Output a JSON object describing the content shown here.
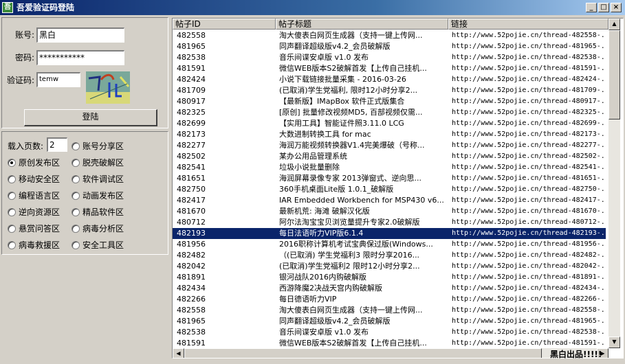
{
  "window": {
    "app_icon_text": "吾",
    "title": "吾爱验证码登陆",
    "minimize": "_",
    "maximize": "□",
    "close": "×"
  },
  "login": {
    "account_label": "账号:",
    "account_value": "黑白",
    "password_label": "密码:",
    "password_value": "***********",
    "captcha_label": "验证码:",
    "captcha_value": "temw",
    "login_button": "登陆"
  },
  "options": {
    "pages_label": "载入页数:",
    "pages_value": "2",
    "selected": "原创发布区",
    "radios": [
      "账号分享区",
      "原创发布区",
      "脱壳破解区",
      "移动安全区",
      "软件调试区",
      "编程语言区",
      "动画发布区",
      "逆向资源区",
      "精品软件区",
      "悬赏问答区",
      "病毒分析区",
      "病毒救援区",
      "安全工具区"
    ]
  },
  "table": {
    "headers": [
      "帖子ID",
      "帖子标题",
      "链接"
    ],
    "selected_index": 19,
    "rows": [
      [
        "482558",
        "淘大傻表白网页生成器（支持一键上传网...",
        "http://www.52pojie.cn/thread-482558-..."
      ],
      [
        "481965",
        "同声翻译超级版v4.2_会员破解版",
        "http://www.52pojie.cn/thread-481965-..."
      ],
      [
        "482538",
        "音乐间谍安卓版 v1.0 发布",
        "http://www.52pojie.cn/thread-482538-..."
      ],
      [
        "481591",
        "微信WEB版本S2破解首发【上传自己挂机...",
        "http://www.52pojie.cn/thread-481591-..."
      ],
      [
        "482424",
        "小说下载链接批量采集 -  2016-03-26",
        "http://www.52pojie.cn/thread-482424-..."
      ],
      [
        "481709",
        "(已取消)学生党福利, 限时12小时分享2...",
        "http://www.52pojie.cn/thread-481709-..."
      ],
      [
        "480917",
        "【最新版】IMapBox 软件正式版集合",
        "http://www.52pojie.cn/thread-480917-..."
      ],
      [
        "482325",
        "[原创] 批量修改视频MD5, 百部视频仅需...",
        "http://www.52pojie.cn/thread-482325-..."
      ],
      [
        "482699",
        "【实用工具】智能证件照3.11.0 LCG",
        "http://www.52pojie.cn/thread-482699-..."
      ],
      [
        "482173",
        "大数进制转换工具 for mac",
        "http://www.52pojie.cn/thread-482173-..."
      ],
      [
        "482277",
        "海润万能视频转换器V1.4完美爆破（号称...",
        "http://www.52pojie.cn/thread-482277-..."
      ],
      [
        "482502",
        "某办公用品管理系统",
        "http://www.52pojie.cn/thread-482502-..."
      ],
      [
        "482541",
        "垃圾小说批量删除",
        "http://www.52pojie.cn/thread-482541-..."
      ],
      [
        "481651",
        "海润屏幕录像专家 2013弹窗式、逆向思...",
        "http://www.52pojie.cn/thread-481651-..."
      ],
      [
        "482750",
        "360手机桌面Lite版 1.0.1_破解版",
        "http://www.52pojie.cn/thread-482750-..."
      ],
      [
        "482417",
        "IAR Embedded Workbench for MSP430 v6...",
        "http://www.52pojie.cn/thread-482417-..."
      ],
      [
        "481670",
        "最新机荒: 海滩 破解汉化版",
        "http://www.52pojie.cn/thread-481670-..."
      ],
      [
        "480712",
        "阿尔法淘宝宝贝浏览量提升专家2.0破解版",
        "http://www.52pojie.cn/thread-480712-..."
      ],
      [
        "482193",
        "每日法语听力VIP版6.1.4",
        "http://www.52pojie.cn/thread-482193-..."
      ],
      [
        "481956",
        "2016职称计算机考试宝典保过版(Windows...",
        "http://www.52pojie.cn/thread-481956-..."
      ],
      [
        "482482",
        "（(已取消) 学生党福利3 限时分享2016...",
        "http://www.52pojie.cn/thread-482482-..."
      ],
      [
        "482042",
        "(已取消)学生党福利2 限时12小时分享2...",
        "http://www.52pojie.cn/thread-482042-..."
      ],
      [
        "481891",
        "银河战队2016内购破解版",
        "http://www.52pojie.cn/thread-481891-..."
      ],
      [
        "482434",
        "西游降魔2决战天宫内购破解版",
        "http://www.52pojie.cn/thread-482434-..."
      ],
      [
        "482266",
        "每日德语听力VIP",
        "http://www.52pojie.cn/thread-482266-..."
      ],
      [
        "482558",
        "淘大傻表白网页生成器（支持一键上传网...",
        "http://www.52pojie.cn/thread-482558-..."
      ],
      [
        "481965",
        "同声翻译超级版v4.2_会员破解版",
        "http://www.52pojie.cn/thread-481965-..."
      ],
      [
        "482538",
        "音乐间谍安卓版 v1.0 发布",
        "http://www.52pojie.cn/thread-482538-..."
      ],
      [
        "481591",
        "微信WEB版本S2破解首发【上传自己挂机...",
        "http://www.52pojie.cn/thread-481591-..."
      ]
    ]
  },
  "status": {
    "text": "黑白出品!!!!!"
  }
}
